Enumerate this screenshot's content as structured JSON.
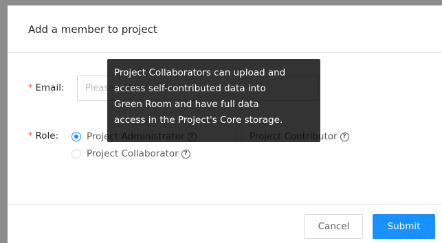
{
  "modal": {
    "title": "Add a member to project"
  },
  "form": {
    "required_mark": "*",
    "email_label": "Email:",
    "email_placeholder": "Please enter email",
    "email_value": "",
    "role_label": "Role:",
    "roles": [
      {
        "label": "Project Administrator",
        "selected": true,
        "help_icon": "question-circle-icon"
      },
      {
        "label": "Project Contributor",
        "selected": false,
        "help_icon": "question-circle-icon"
      },
      {
        "label": "Project Collaborator",
        "selected": false,
        "help_icon": "question-circle-icon"
      }
    ]
  },
  "tooltip": {
    "lines": [
      "Project Collaborators can upload and",
      "access self-contributed data into",
      "Green Room and have full data",
      "access in the Project's Core storage."
    ]
  },
  "footer": {
    "cancel_label": "Cancel",
    "submit_label": "Submit"
  },
  "colors": {
    "primary": "#1890ff",
    "required": "#ff4d4f",
    "tooltip_bg": "rgba(0,0,0,0.80)",
    "overlay": "#8c8c8c"
  }
}
